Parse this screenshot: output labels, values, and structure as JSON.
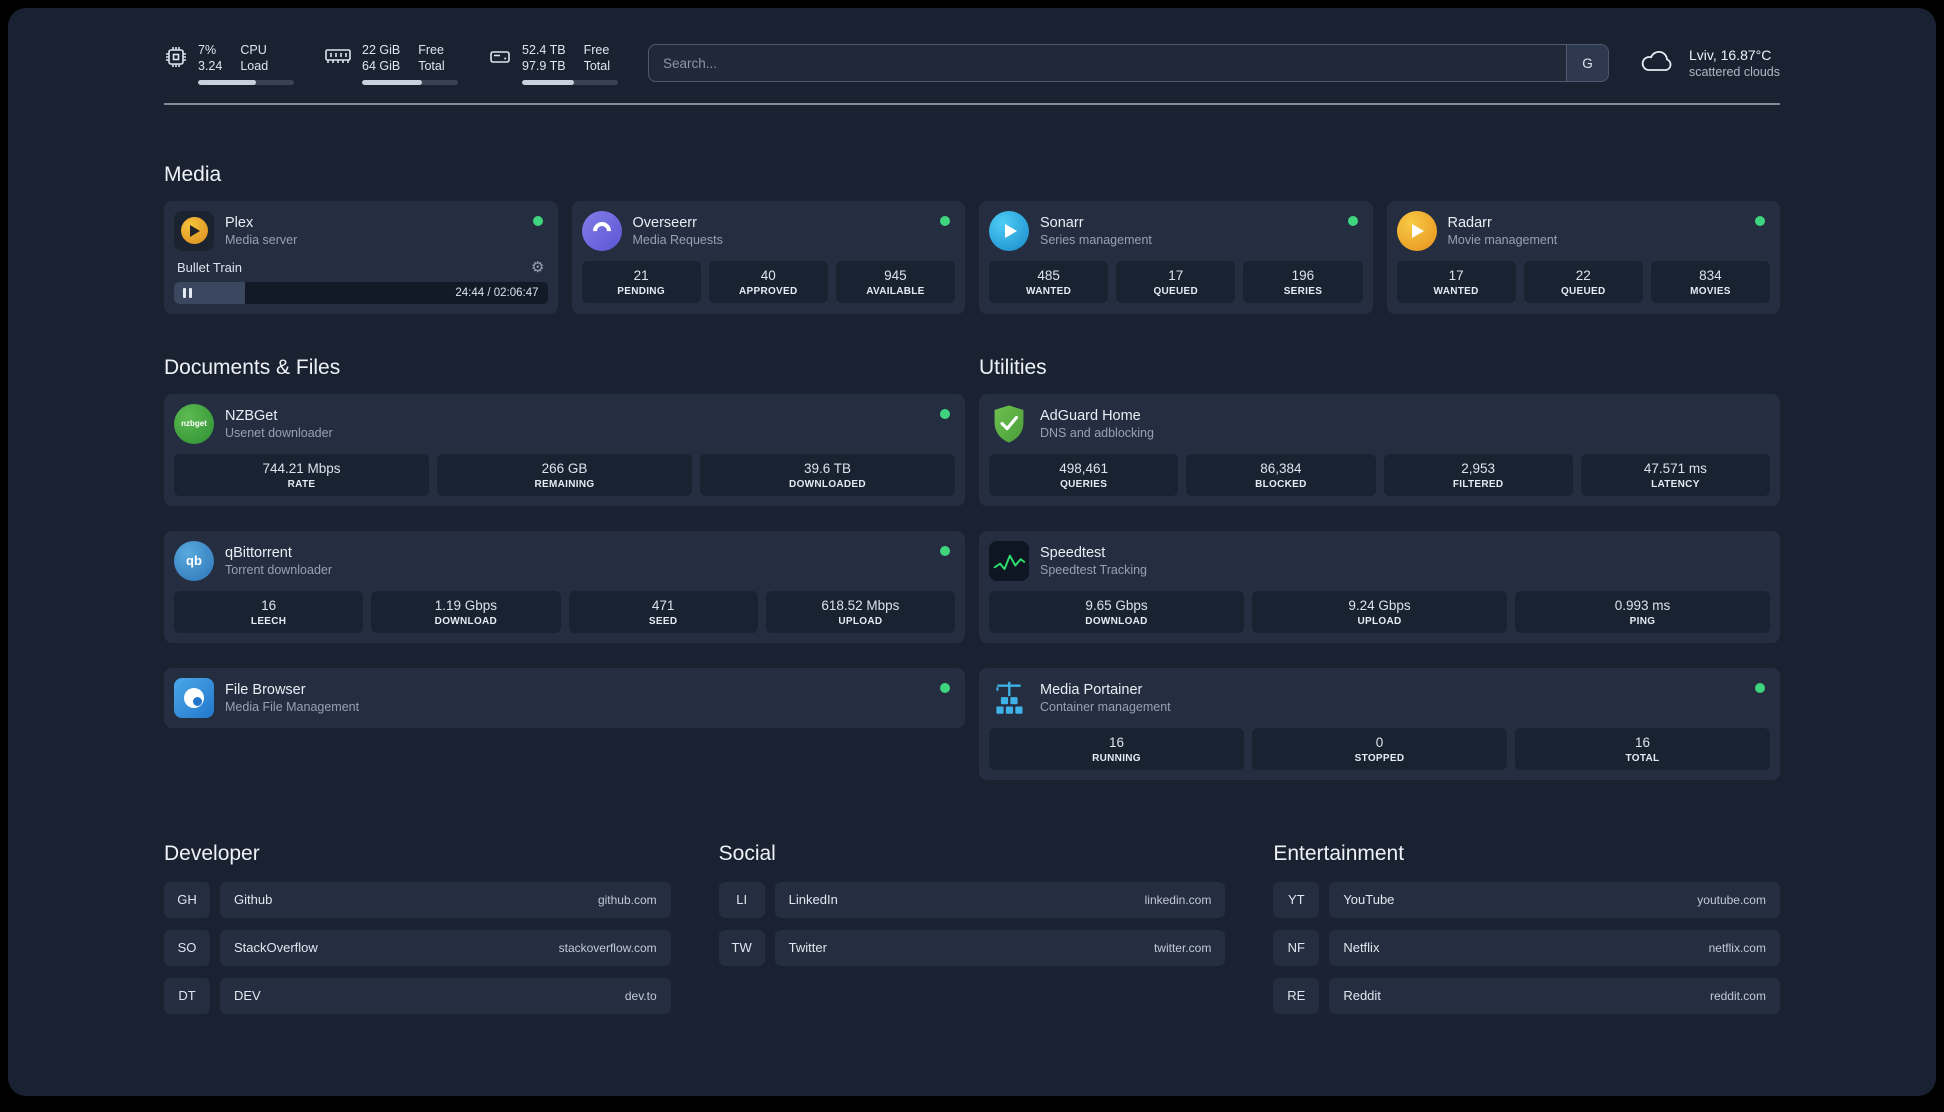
{
  "header": {
    "cpu": {
      "value_top": "7%",
      "value_bottom": "3.24",
      "label_top": "CPU",
      "label_bottom": "Load",
      "progress": 60
    },
    "memory": {
      "value_top": "22 GiB",
      "value_bottom": "64 GiB",
      "label_top": "Free",
      "label_bottom": "Total",
      "progress": 63
    },
    "disk": {
      "value_top": "52.4 TB",
      "value_bottom": "97.9 TB",
      "label_top": "Free",
      "label_bottom": "Total",
      "progress": 54
    },
    "search": {
      "placeholder": "Search...",
      "button_label": "G"
    },
    "weather": {
      "location": "Lviv, 16.87°C",
      "condition": "scattered clouds"
    }
  },
  "sections": {
    "media": {
      "title": "Media"
    },
    "documents": {
      "title": "Documents & Files"
    },
    "utilities": {
      "title": "Utilities"
    }
  },
  "services": {
    "plex": {
      "name": "Plex",
      "desc": "Media server",
      "online": true,
      "now_playing": "Bullet Train",
      "time": "24:44 / 02:06:47",
      "progress": 19
    },
    "overseerr": {
      "name": "Overseerr",
      "desc": "Media Requests",
      "online": true,
      "stats": [
        {
          "value": "21",
          "label": "PENDING"
        },
        {
          "value": "40",
          "label": "APPROVED"
        },
        {
          "value": "945",
          "label": "AVAILABLE"
        }
      ]
    },
    "sonarr": {
      "name": "Sonarr",
      "desc": "Series management",
      "online": true,
      "stats": [
        {
          "value": "485",
          "label": "WANTED"
        },
        {
          "value": "17",
          "label": "QUEUED"
        },
        {
          "value": "196",
          "label": "SERIES"
        }
      ]
    },
    "radarr": {
      "name": "Radarr",
      "desc": "Movie management",
      "online": true,
      "stats": [
        {
          "value": "17",
          "label": "WANTED"
        },
        {
          "value": "22",
          "label": "QUEUED"
        },
        {
          "value": "834",
          "label": "MOVIES"
        }
      ]
    },
    "nzbget": {
      "name": "NZBGet",
      "desc": "Usenet downloader",
      "online": true,
      "icon_text": "nzbget",
      "stats": [
        {
          "value": "744.21 Mbps",
          "label": "RATE"
        },
        {
          "value": "266 GB",
          "label": "REMAINING"
        },
        {
          "value": "39.6 TB",
          "label": "DOWNLOADED"
        }
      ]
    },
    "qbittorrent": {
      "name": "qBittorrent",
      "desc": "Torrent downloader",
      "online": true,
      "icon_text": "qb",
      "stats": [
        {
          "value": "16",
          "label": "LEECH"
        },
        {
          "value": "1.19 Gbps",
          "label": "DOWNLOAD"
        },
        {
          "value": "471",
          "label": "SEED"
        },
        {
          "value": "618.52 Mbps",
          "label": "UPLOAD"
        }
      ]
    },
    "filebrowser": {
      "name": "File Browser",
      "desc": "Media File Management",
      "online": true
    },
    "adguard": {
      "name": "AdGuard Home",
      "desc": "DNS and adblocking",
      "online": false,
      "stats": [
        {
          "value": "498,461",
          "label": "QUERIES"
        },
        {
          "value": "86,384",
          "label": "BLOCKED"
        },
        {
          "value": "2,953",
          "label": "FILTERED"
        },
        {
          "value": "47.571 ms",
          "label": "LATENCY"
        }
      ]
    },
    "speedtest": {
      "name": "Speedtest",
      "desc": "Speedtest Tracking",
      "online": false,
      "stats": [
        {
          "value": "9.65 Gbps",
          "label": "DOWNLOAD"
        },
        {
          "value": "9.24 Gbps",
          "label": "UPLOAD"
        },
        {
          "value": "0.993 ms",
          "label": "PING"
        }
      ]
    },
    "portainer": {
      "name": "Media Portainer",
      "desc": "Container management",
      "online": true,
      "stats": [
        {
          "value": "16",
          "label": "RUNNING"
        },
        {
          "value": "0",
          "label": "STOPPED"
        },
        {
          "value": "16",
          "label": "TOTAL"
        }
      ]
    }
  },
  "bookmarks": {
    "developer": {
      "title": "Developer",
      "items": [
        {
          "abbr": "GH",
          "name": "Github",
          "domain": "github.com"
        },
        {
          "abbr": "SO",
          "name": "StackOverflow",
          "domain": "stackoverflow.com"
        },
        {
          "abbr": "DT",
          "name": "DEV",
          "domain": "dev.to"
        }
      ]
    },
    "social": {
      "title": "Social",
      "items": [
        {
          "abbr": "LI",
          "name": "LinkedIn",
          "domain": "linkedin.com"
        },
        {
          "abbr": "TW",
          "name": "Twitter",
          "domain": "twitter.com"
        }
      ]
    },
    "entertainment": {
      "title": "Entertainment",
      "items": [
        {
          "abbr": "YT",
          "name": "YouTube",
          "domain": "youtube.com"
        },
        {
          "abbr": "NF",
          "name": "Netflix",
          "domain": "netflix.com"
        },
        {
          "abbr": "RE",
          "name": "Reddit",
          "domain": "reddit.com"
        }
      ]
    }
  }
}
